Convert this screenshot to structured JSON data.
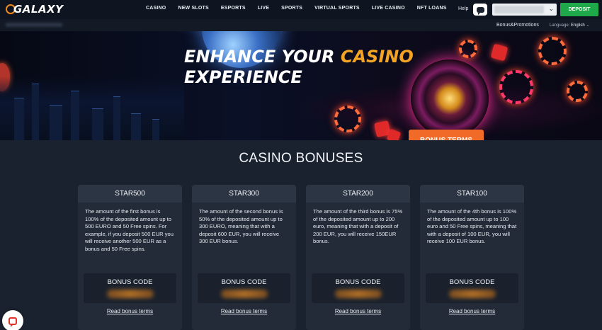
{
  "header": {
    "logo": "GALAXY",
    "nav": [
      "CASINO",
      "NEW SLOTS",
      "ESPORTS",
      "LIVE",
      "SPORTS",
      "VIRTUAL SPORTS",
      "LIVE CASINO",
      "NFT LOANS"
    ],
    "help": "Help",
    "deposit": "DEPOSIT"
  },
  "subbar": {
    "promotions": "Bonus&Promotions",
    "language_label": "Language:",
    "language_value": "English",
    "language_chevron": "⌄"
  },
  "banner": {
    "title_line1_a": "ENHANCE YOUR ",
    "title_line1_b": "CASINO",
    "title_line2": "EXPERIENCE",
    "button": "BONUS TERMS"
  },
  "section": {
    "title": "CASINO BONUSES"
  },
  "bonuses": [
    {
      "name": "STAR500",
      "text": "The amount of the first bonus is 100% of the deposited amount up to 500 EURO and 50 Free spins. For example, if you deposit 500 EUR you will receive another 500 EUR as a bonus and 50 Free spins.",
      "code_label": "BONUS CODE",
      "link": "Read bonus terms"
    },
    {
      "name": "STAR300",
      "text": "The amount of the second bonus is 50% of the deposited amount up to 300 EURO, meaning that with a deposit 600 EUR, you will receive 300 EUR bonus.",
      "code_label": "BONUS CODE",
      "link": "Read bonus terms"
    },
    {
      "name": "STAR200",
      "text": "The amount of the third bonus is 75% of the deposited amount up to 200 euro, meaning that with a deposit of 200 EUR, you will receive 150EUR bonus.",
      "code_label": "BONUS CODE",
      "link": "Read bonus terms"
    },
    {
      "name": "STAR100",
      "text": "The amount of the 4th bonus is 100% of the deposited amount up to 100 euro and 50 Free spins, meaning that with a deposit of 100 EUR, you will receive 100 EUR bonus.",
      "code_label": "BONUS CODE",
      "link": "Read bonus terms"
    }
  ],
  "icons": {
    "chat": "chat-icon",
    "livechat": "livechat-icon",
    "dropdown": "chevron-down-icon"
  },
  "colors": {
    "accent": "#f3a425",
    "deposit": "#1fa84a",
    "banner_button": "#f26a27",
    "background": "#1a2230"
  }
}
